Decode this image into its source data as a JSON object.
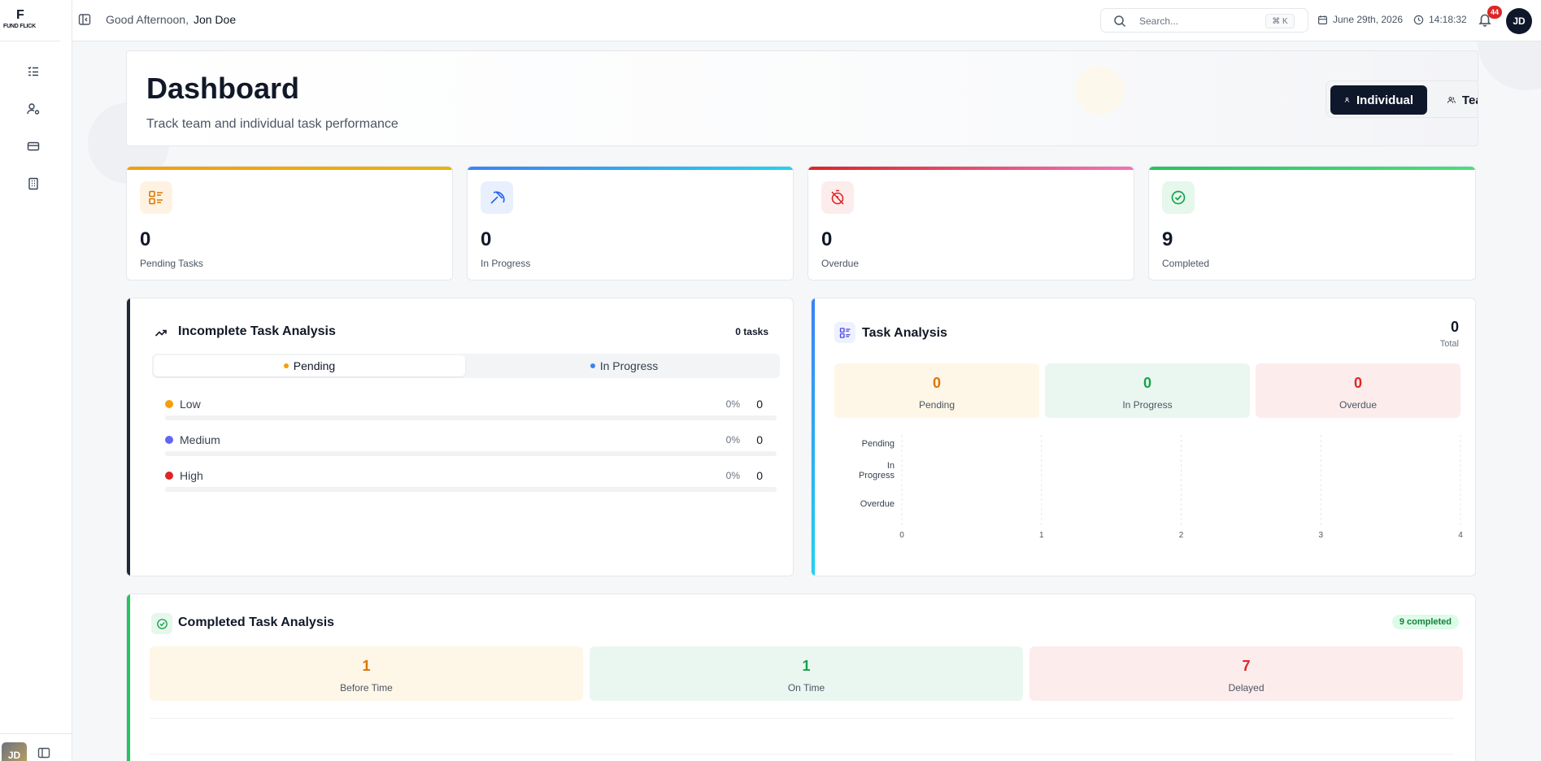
{
  "brand": {
    "logo_mark": "F",
    "logo_text": "FUND FLICK",
    "user_initials": "JD"
  },
  "sidebar": {
    "items": [
      {
        "icon": "task-list-icon"
      },
      {
        "icon": "user-settings-icon"
      },
      {
        "icon": "credit-card-icon"
      },
      {
        "icon": "building-icon"
      }
    ]
  },
  "header": {
    "greeting": "Good Afternoon,",
    "user_name": "Jon Doe",
    "search_placeholder": "Search...",
    "search_shortcut": "⌘ K",
    "date": "June 29th, 2026",
    "time": "14:18:32",
    "notification_count": "44",
    "avatar_initials": "JD"
  },
  "hero": {
    "title": "Dashboard",
    "subtitle": "Track team and individual task performance",
    "toggle_individual": "Individual",
    "toggle_team": "Team",
    "selected": "Individual"
  },
  "stats": [
    {
      "value": "0",
      "label": "Pending Tasks",
      "color": "#eab308",
      "icon": "checklist-icon"
    },
    {
      "value": "0",
      "label": "In Progress",
      "color": "#3b82f6",
      "icon": "pickaxe-icon"
    },
    {
      "value": "0",
      "label": "Overdue",
      "color": "#ef4444",
      "icon": "timer-off-icon"
    },
    {
      "value": "9",
      "label": "Completed",
      "color": "#22c55e",
      "icon": "check-circle-icon"
    }
  ],
  "incomplete": {
    "title": "Incomplete Task Analysis",
    "count_label": "0 tasks",
    "tabs": [
      {
        "label": "Pending",
        "color": "#f59e0b"
      },
      {
        "label": "In Progress",
        "color": "#3b82f6"
      }
    ],
    "active_tab": "Pending",
    "priorities": [
      {
        "name": "Low",
        "percent": "0%",
        "count": "0",
        "fraction": 0,
        "color": "#f59e0b"
      },
      {
        "name": "Medium",
        "percent": "0%",
        "count": "0",
        "fraction": 0,
        "color": "#6366f1"
      },
      {
        "name": "High",
        "percent": "0%",
        "count": "0",
        "fraction": 0,
        "color": "#dc2626"
      }
    ]
  },
  "task_analysis": {
    "title": "Task Analysis",
    "total_value": "0",
    "total_label": "Total",
    "cards": [
      {
        "value": "0",
        "label": "Pending",
        "color": "#d97706",
        "bg": "#fef6e7"
      },
      {
        "value": "0",
        "label": "In Progress",
        "color": "#16a34a",
        "bg": "#eaf7f0"
      },
      {
        "value": "0",
        "label": "Overdue",
        "color": "#dc2626",
        "bg": "#fdecec"
      }
    ]
  },
  "chart_data": {
    "type": "bar",
    "orientation": "horizontal",
    "categories": [
      "Pending",
      "In Progress",
      "Overdue"
    ],
    "values": [
      0,
      0,
      0
    ],
    "xlim": [
      0,
      4
    ],
    "xticks": [
      "0",
      "1",
      "2",
      "3",
      "4"
    ],
    "grid": true
  },
  "completed": {
    "title": "Completed Task Analysis",
    "badge": "9 completed",
    "cards": [
      {
        "value": "1",
        "label": "Before Time",
        "color": "#d97706",
        "bg": "#fef6e7"
      },
      {
        "value": "1",
        "label": "On Time",
        "color": "#16a34a",
        "bg": "#eaf7f0"
      },
      {
        "value": "7",
        "label": "Delayed",
        "color": "#dc2626",
        "bg": "#fdecec"
      }
    ]
  }
}
